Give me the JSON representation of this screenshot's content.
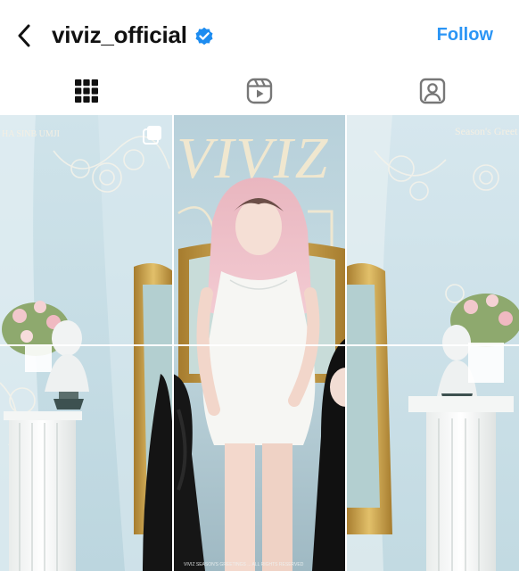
{
  "header": {
    "back_icon": "chevron-left-icon",
    "username": "viviz_official",
    "verified_icon": "verified-badge-icon",
    "follow_label": "Follow",
    "accent_color": "#2b95f5"
  },
  "tabs": [
    {
      "icon": "grid-icon",
      "selected": true
    },
    {
      "icon": "reels-icon",
      "selected": false
    },
    {
      "icon": "tagged-icon",
      "selected": false
    }
  ],
  "posts": {
    "left_header_text": "HA SINB UMJI",
    "center_title": "VIVIZ",
    "right_header_text": "Season's Greet",
    "bottom_caption": "VIVIZ SEASON'S GREETINGS ... ALL RIGHTS RESERVED",
    "multi_icon": "carousel-icon"
  }
}
